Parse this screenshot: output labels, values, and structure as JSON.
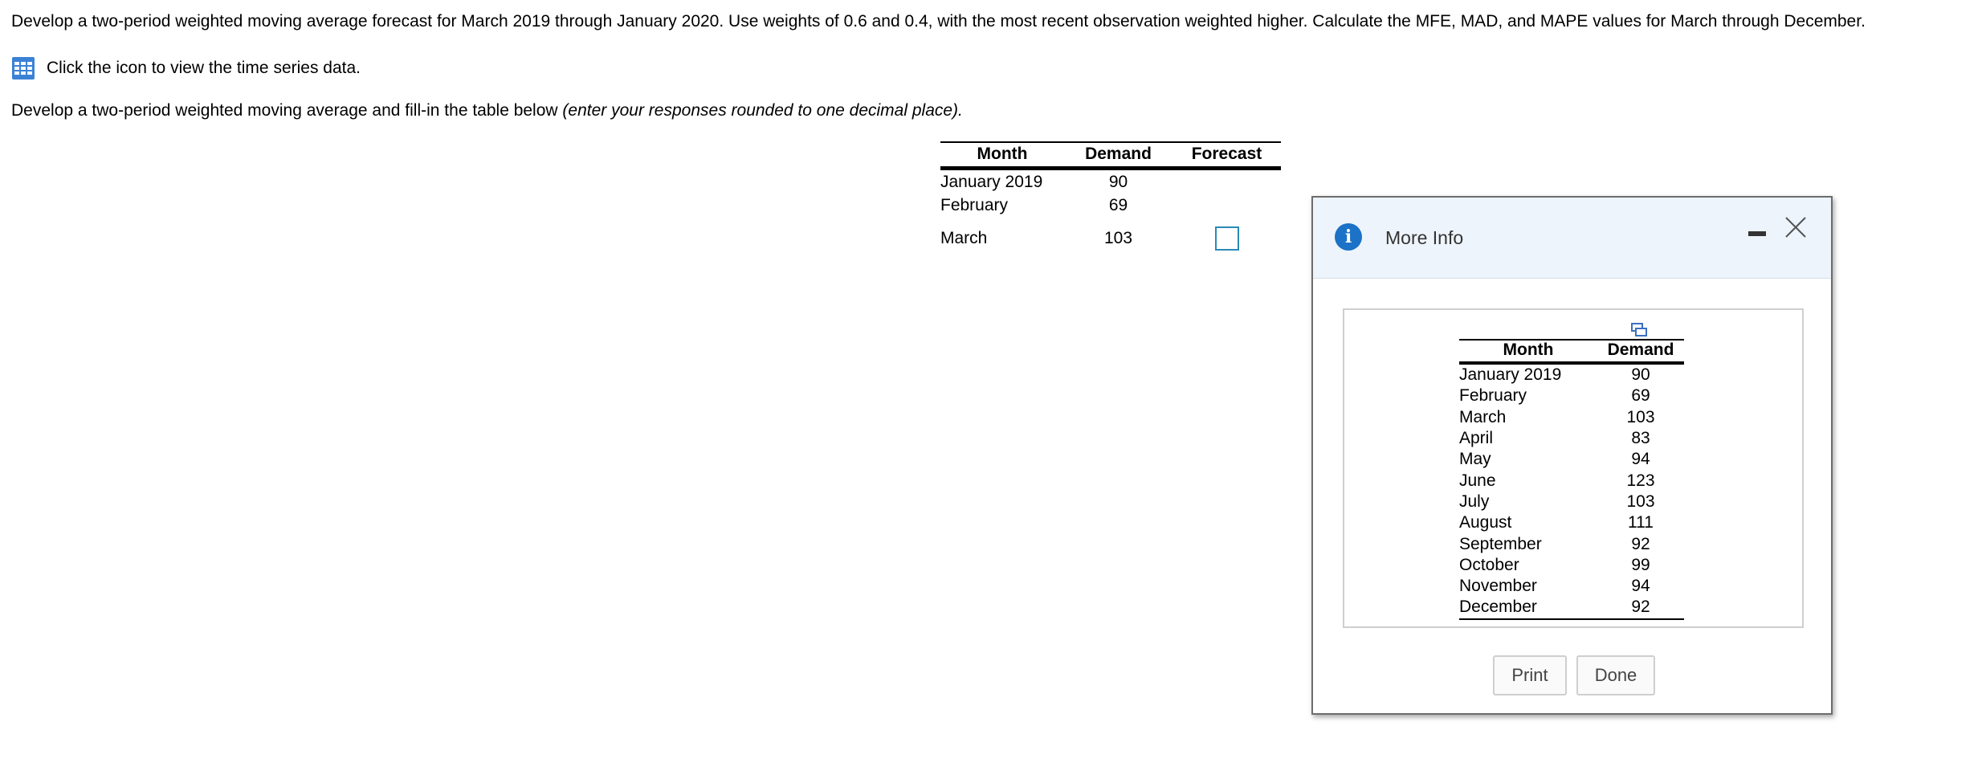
{
  "question": {
    "problem_text": "Develop a two-period weighted moving average forecast for March 2019 through January 2020. Use weights of 0.6 and 0.4, with the most recent observation weighted higher. Calculate the MFE, MAD, and MAPE values for March through December.",
    "data_link_text": "Click the icon to view the time series data.",
    "instruction_text": "Develop a two-period weighted moving average and fill-in the table below ",
    "instruction_italic": "(enter your responses rounded to one decimal place)."
  },
  "main_table": {
    "headers": {
      "month": "Month",
      "demand": "Demand",
      "forecast": "Forecast"
    },
    "rows": [
      {
        "month": "January 2019",
        "demand": "90",
        "forecast": ""
      },
      {
        "month": "February",
        "demand": "69",
        "forecast": ""
      },
      {
        "month": "March",
        "demand": "103",
        "forecast": "",
        "has_input": true
      }
    ]
  },
  "dialog": {
    "title": "More Info",
    "headers": {
      "month": "Month",
      "demand": "Demand"
    },
    "rows": [
      {
        "month": "January 2019",
        "demand": "90"
      },
      {
        "month": "February",
        "demand": "69"
      },
      {
        "month": "March",
        "demand": "103"
      },
      {
        "month": "April",
        "demand": "83"
      },
      {
        "month": "May",
        "demand": "94"
      },
      {
        "month": "June",
        "demand": "123"
      },
      {
        "month": "July",
        "demand": "103"
      },
      {
        "month": "August",
        "demand": "111"
      },
      {
        "month": "September",
        "demand": "92"
      },
      {
        "month": "October",
        "demand": "99"
      },
      {
        "month": "November",
        "demand": "94"
      },
      {
        "month": "December",
        "demand": "92"
      }
    ],
    "print_label": "Print",
    "done_label": "Done"
  },
  "icons": {
    "data_link": "table-grid-icon",
    "info": "info-icon",
    "minimize": "minimize-icon",
    "close": "close-icon",
    "copy": "copy-icon"
  },
  "colors": {
    "link_icon": "#3b82d6",
    "input_border": "#2a8ab7",
    "dialog_header_bg": "#eef4fb",
    "info_icon": "#1b72c6"
  }
}
